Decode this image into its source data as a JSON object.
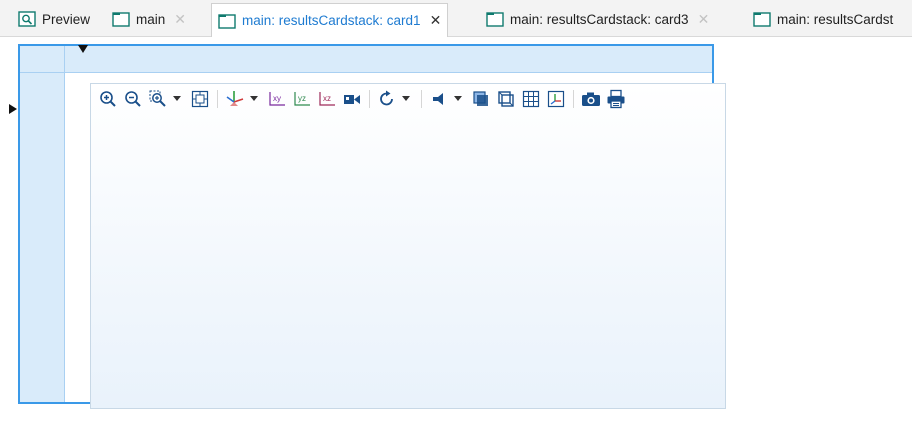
{
  "colors": {
    "accent": "#1e7bd1",
    "frame_border": "#3a99e8",
    "header_band": "#d9ebfa",
    "tab_icon_green": "#0f7a6e",
    "plot_gradient_bottom": "#e9f2fb"
  },
  "tabs": [
    {
      "label": "Preview",
      "icon": "preview-icon",
      "closable": false,
      "active": false
    },
    {
      "label": "main",
      "icon": "folder-icon",
      "closable": true,
      "active": false
    },
    {
      "label": "main: resultsCardstack: card1",
      "icon": "folder-icon",
      "closable": true,
      "active": true
    },
    {
      "label": "main: resultsCardstack: card3",
      "icon": "folder-icon",
      "closable": true,
      "active": false
    },
    {
      "label": "main: resultsCardst",
      "icon": "folder-icon",
      "closable": false,
      "active": false
    }
  ],
  "close_glyph": "✕",
  "toolbar": [
    {
      "group": "zoom",
      "icons": [
        "zoom-in-icon",
        "zoom-out-icon",
        "zoom-box-icon",
        "zoom-extents-icon"
      ]
    },
    {
      "group": "views",
      "icons": [
        "axis-orientation-icon",
        "xy-plane-icon",
        "yz-plane-icon",
        "xz-plane-icon",
        "camera-view-icon"
      ]
    },
    {
      "group": "rotate",
      "icons": [
        "rotate-icon"
      ]
    },
    {
      "group": "display",
      "icons": [
        "scene-light-icon",
        "transparency-icon",
        "wireframe-icon",
        "grid-icon",
        "axis-triad-icon"
      ]
    },
    {
      "group": "output",
      "icons": [
        "snapshot-camera-icon",
        "print-icon"
      ]
    }
  ]
}
